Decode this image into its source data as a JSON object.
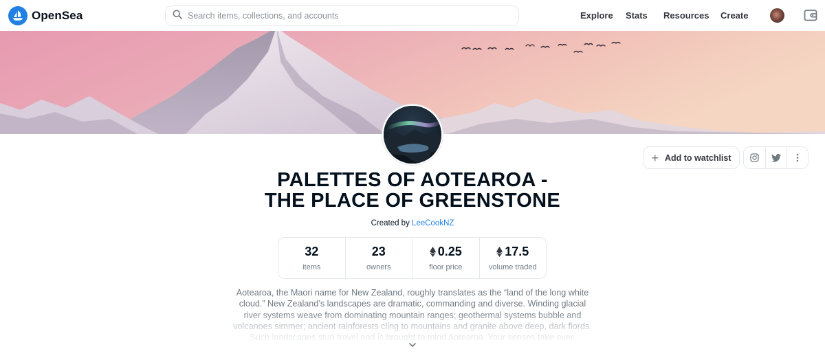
{
  "header": {
    "brand": "OpenSea",
    "search_placeholder": "Search items, collections, and accounts",
    "nav": [
      {
        "label": "Explore"
      },
      {
        "label": "Stats"
      },
      {
        "label": "Resources"
      },
      {
        "label": "Create"
      }
    ],
    "icons": [
      "opensea-logo-icon",
      "search-icon",
      "profile-avatar",
      "wallet-icon"
    ]
  },
  "collection": {
    "title_line1": "PALETTES OF AOTEAROA -",
    "title_line2": "THE PLACE OF GREENSTONE",
    "created_prefix": "Created by",
    "creator": "LeeCookNZ",
    "actions": {
      "watchlist_label": "Add to watchlist",
      "icons": [
        "plus-icon",
        "instagram-icon",
        "twitter-icon",
        "more-vertical-icon"
      ]
    },
    "stats": [
      {
        "value": "32",
        "label": "items",
        "eth": false
      },
      {
        "value": "23",
        "label": "owners",
        "eth": false
      },
      {
        "value": "0.25",
        "label": "floor price",
        "eth": true
      },
      {
        "value": "17.5",
        "label": "volume traded",
        "eth": true
      }
    ],
    "description": "Aotearoa, the Maori name for New Zealand, roughly translates as the “land of the long white cloud.” New Zealand’s landscapes are dramatic, commanding and diverse. Winding glacial river systems weave from dominating mountain ranges; geothermal systems bubble and volcanoes simmer; ancient rainforests cling to mountains and granite above deep, dark fiords. Such landscapes stun travel and is brought to mind Aotearoa. Your senses take over.",
    "expand_icon": "chevron-down-icon"
  },
  "colors": {
    "brand_blue": "#2081e2",
    "text_primary": "#04111d",
    "text_secondary": "#707a83",
    "border": "#e5e8eb"
  }
}
